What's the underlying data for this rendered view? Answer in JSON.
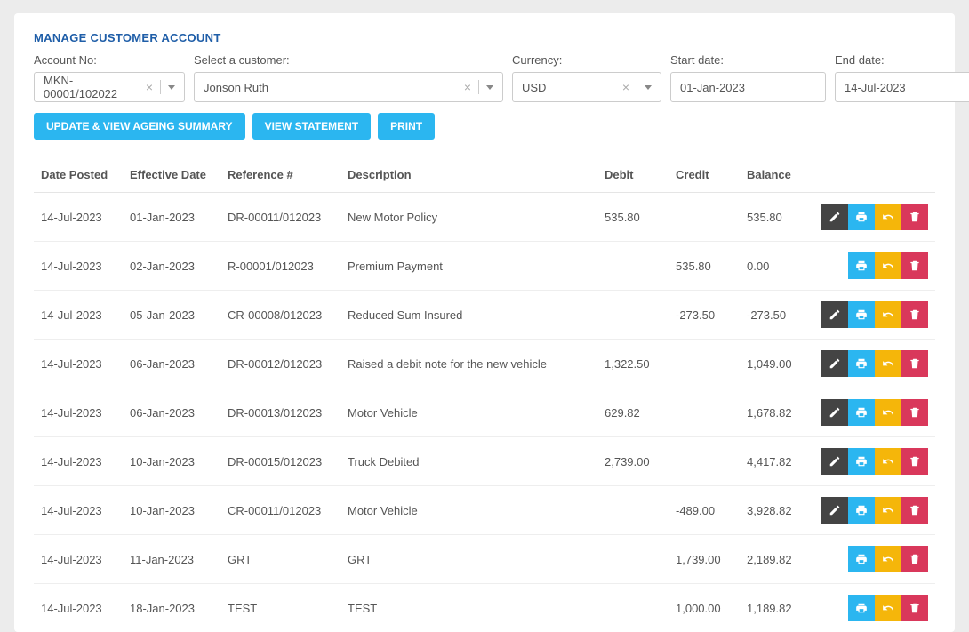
{
  "title": "MANAGE CUSTOMER ACCOUNT",
  "filters": {
    "account_no_label": "Account No:",
    "account_no": "MKN-00001/102022",
    "customer_label": "Select a customer:",
    "customer": "Jonson Ruth",
    "currency_label": "Currency:",
    "currency": "USD",
    "start_label": "Start date:",
    "start": "01-Jan-2023",
    "end_label": "End date:",
    "end": "14-Jul-2023"
  },
  "buttons": {
    "update": "UPDATE & VIEW AGEING SUMMARY",
    "view": "VIEW STATEMENT",
    "print": "PRINT"
  },
  "columns": {
    "posted": "Date Posted",
    "effective": "Effective Date",
    "ref": "Reference #",
    "desc": "Description",
    "debit": "Debit",
    "credit": "Credit",
    "balance": "Balance"
  },
  "rows": [
    {
      "posted": "14-Jul-2023",
      "effective": "01-Jan-2023",
      "ref": "DR-00011/012023",
      "desc": "New Motor Policy",
      "debit": "535.80",
      "credit": "",
      "balance": "535.80",
      "actions": [
        "edit",
        "print",
        "undo",
        "del"
      ]
    },
    {
      "posted": "14-Jul-2023",
      "effective": "02-Jan-2023",
      "ref": "R-00001/012023",
      "desc": "Premium Payment",
      "debit": "",
      "credit": "535.80",
      "balance": "0.00",
      "actions": [
        "print",
        "undo",
        "del"
      ]
    },
    {
      "posted": "14-Jul-2023",
      "effective": "05-Jan-2023",
      "ref": "CR-00008/012023",
      "desc": "Reduced Sum Insured",
      "debit": "",
      "credit": "-273.50",
      "balance": "-273.50",
      "actions": [
        "edit",
        "print",
        "undo",
        "del"
      ]
    },
    {
      "posted": "14-Jul-2023",
      "effective": "06-Jan-2023",
      "ref": "DR-00012/012023",
      "desc": "Raised a debit note for the new vehicle",
      "debit": "1,322.50",
      "credit": "",
      "balance": "1,049.00",
      "actions": [
        "edit",
        "print",
        "undo",
        "del"
      ]
    },
    {
      "posted": "14-Jul-2023",
      "effective": "06-Jan-2023",
      "ref": "DR-00013/012023",
      "desc": "Motor Vehicle",
      "debit": "629.82",
      "credit": "",
      "balance": "1,678.82",
      "actions": [
        "edit",
        "print",
        "undo",
        "del"
      ]
    },
    {
      "posted": "14-Jul-2023",
      "effective": "10-Jan-2023",
      "ref": "DR-00015/012023",
      "desc": "Truck Debited",
      "debit": "2,739.00",
      "credit": "",
      "balance": "4,417.82",
      "actions": [
        "edit",
        "print",
        "undo",
        "del"
      ]
    },
    {
      "posted": "14-Jul-2023",
      "effective": "10-Jan-2023",
      "ref": "CR-00011/012023",
      "desc": "Motor Vehicle",
      "debit": "",
      "credit": "-489.00",
      "balance": "3,928.82",
      "actions": [
        "edit",
        "print",
        "undo",
        "del"
      ]
    },
    {
      "posted": "14-Jul-2023",
      "effective": "11-Jan-2023",
      "ref": "GRT",
      "desc": "GRT",
      "debit": "",
      "credit": "1,739.00",
      "balance": "2,189.82",
      "actions": [
        "print",
        "undo",
        "del"
      ]
    },
    {
      "posted": "14-Jul-2023",
      "effective": "18-Jan-2023",
      "ref": "TEST",
      "desc": "TEST",
      "debit": "",
      "credit": "1,000.00",
      "balance": "1,189.82",
      "actions": [
        "print",
        "undo",
        "del"
      ]
    }
  ]
}
